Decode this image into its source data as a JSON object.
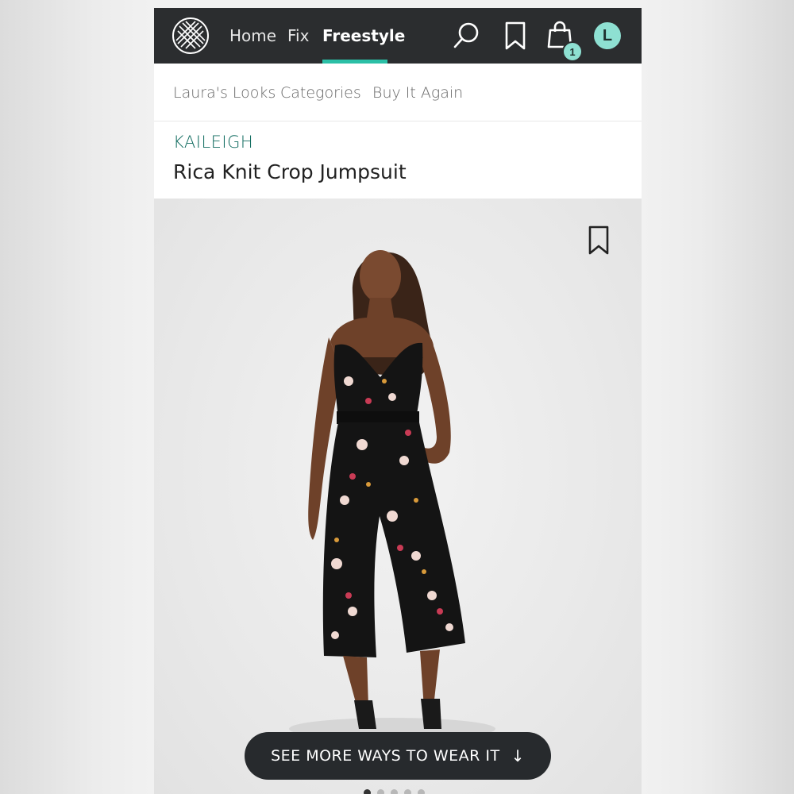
{
  "nav": {
    "links": {
      "home": "Home",
      "fix": "Fix",
      "freestyle": "Freestyle"
    },
    "active": "Freestyle",
    "cart_count": "1",
    "avatar_initial": "L",
    "accent_color": "#2bbfa6",
    "icons": [
      "stitch-fix-logo-icon",
      "search-icon",
      "bookmark-icon",
      "shopping-bag-icon"
    ]
  },
  "subnav": {
    "items": [
      "Laura's Looks",
      "Categories",
      "Buy It Again"
    ]
  },
  "product": {
    "brand": "KAILEIGH",
    "name": "Rica Knit Crop Jumpsuit",
    "brand_color": "#0f6b5f"
  },
  "cta": {
    "label": "SEE MORE WAYS TO WEAR IT",
    "icon": "arrow-down-icon"
  },
  "carousel": {
    "count": 5,
    "active_index": 0
  }
}
